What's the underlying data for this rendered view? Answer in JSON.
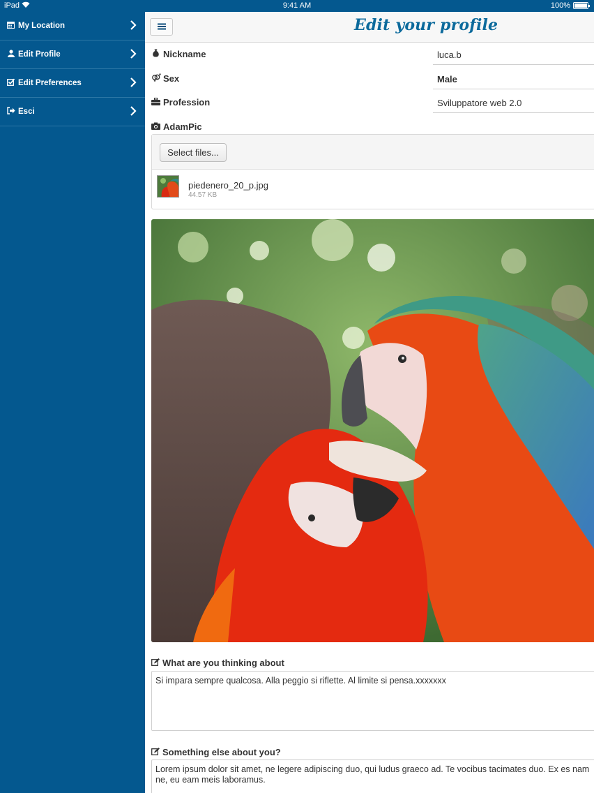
{
  "status_bar": {
    "device": "iPad",
    "time": "9:41 AM",
    "battery": "100%"
  },
  "sidebar": {
    "items": [
      {
        "label": "My Location",
        "icon": "calendar-icon"
      },
      {
        "label": "Edit Profile",
        "icon": "user-icon"
      },
      {
        "label": "Edit Preferences",
        "icon": "check-square-icon"
      },
      {
        "label": "Esci",
        "icon": "sign-out-icon"
      }
    ]
  },
  "header": {
    "title": "Edit your profile"
  },
  "form": {
    "nickname": {
      "label": "Nickname",
      "value": "luca.b"
    },
    "sex": {
      "label": "Sex",
      "value": "Male"
    },
    "profession": {
      "label": "Profession",
      "value": "Sviluppatore web 2.0"
    },
    "adampic": {
      "label": "AdamPic",
      "button": "Select files...",
      "file_name": "piedenero_20_p.jpg",
      "file_size": "44.57 KB"
    },
    "thinking": {
      "label": "What are you thinking about",
      "value": "Si impara sempre qualcosa. Alla peggio si riflette. Al limite si pensa.xxxxxxx"
    },
    "something_else": {
      "label": "Something else about you?",
      "value": "Lorem ipsum dolor sit amet, ne legere adipiscing duo, qui ludus graeco ad. Te vocibus tacimates duo. Ex es nam ne, eu eam meis laboramus."
    }
  },
  "colors": {
    "sidebar_bg": "#04588f",
    "title": "#0c6a9c"
  }
}
